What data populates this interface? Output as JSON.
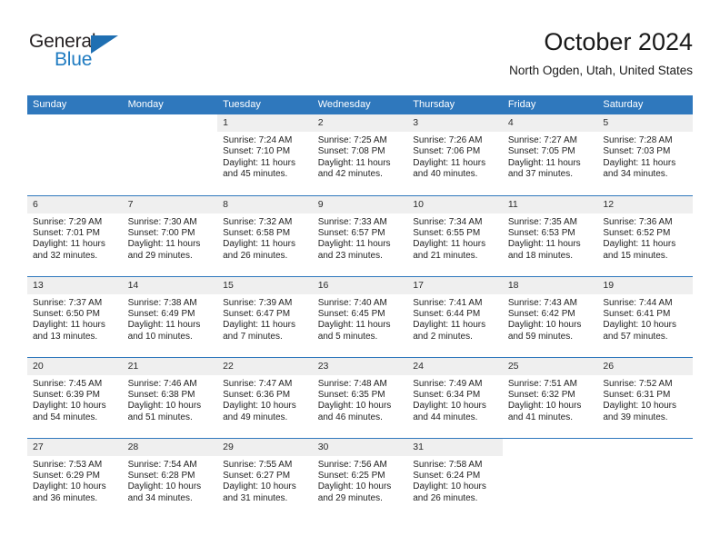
{
  "brand": {
    "name_top": "General",
    "name_bottom": "Blue",
    "triangle_color": "#1f6fb2",
    "text_color_top": "#231f20",
    "text_color_bottom": "#1f7bc1"
  },
  "header": {
    "title": "October 2024",
    "subtitle": "North Ogden, Utah, United States"
  },
  "theme": {
    "header_bg": "#2f78bd",
    "header_text": "#ffffff",
    "daynum_bg": "#efefef",
    "row_separator": "#2f78bd",
    "body_bg": "#ffffff"
  },
  "weekdays": [
    "Sunday",
    "Monday",
    "Tuesday",
    "Wednesday",
    "Thursday",
    "Friday",
    "Saturday"
  ],
  "labels": {
    "sunrise_prefix": "Sunrise:",
    "sunset_prefix": "Sunset:",
    "daylight_prefix": "Daylight:"
  },
  "weeks": [
    [
      {
        "day": "",
        "blank": true
      },
      {
        "day": "",
        "blank": true
      },
      {
        "day": "1",
        "sunrise": "Sunrise: 7:24 AM",
        "sunset": "Sunset: 7:10 PM",
        "daylight_1": "Daylight: 11 hours",
        "daylight_2": "and 45 minutes."
      },
      {
        "day": "2",
        "sunrise": "Sunrise: 7:25 AM",
        "sunset": "Sunset: 7:08 PM",
        "daylight_1": "Daylight: 11 hours",
        "daylight_2": "and 42 minutes."
      },
      {
        "day": "3",
        "sunrise": "Sunrise: 7:26 AM",
        "sunset": "Sunset: 7:06 PM",
        "daylight_1": "Daylight: 11 hours",
        "daylight_2": "and 40 minutes."
      },
      {
        "day": "4",
        "sunrise": "Sunrise: 7:27 AM",
        "sunset": "Sunset: 7:05 PM",
        "daylight_1": "Daylight: 11 hours",
        "daylight_2": "and 37 minutes."
      },
      {
        "day": "5",
        "sunrise": "Sunrise: 7:28 AM",
        "sunset": "Sunset: 7:03 PM",
        "daylight_1": "Daylight: 11 hours",
        "daylight_2": "and 34 minutes."
      }
    ],
    [
      {
        "day": "6",
        "sunrise": "Sunrise: 7:29 AM",
        "sunset": "Sunset: 7:01 PM",
        "daylight_1": "Daylight: 11 hours",
        "daylight_2": "and 32 minutes."
      },
      {
        "day": "7",
        "sunrise": "Sunrise: 7:30 AM",
        "sunset": "Sunset: 7:00 PM",
        "daylight_1": "Daylight: 11 hours",
        "daylight_2": "and 29 minutes."
      },
      {
        "day": "8",
        "sunrise": "Sunrise: 7:32 AM",
        "sunset": "Sunset: 6:58 PM",
        "daylight_1": "Daylight: 11 hours",
        "daylight_2": "and 26 minutes."
      },
      {
        "day": "9",
        "sunrise": "Sunrise: 7:33 AM",
        "sunset": "Sunset: 6:57 PM",
        "daylight_1": "Daylight: 11 hours",
        "daylight_2": "and 23 minutes."
      },
      {
        "day": "10",
        "sunrise": "Sunrise: 7:34 AM",
        "sunset": "Sunset: 6:55 PM",
        "daylight_1": "Daylight: 11 hours",
        "daylight_2": "and 21 minutes."
      },
      {
        "day": "11",
        "sunrise": "Sunrise: 7:35 AM",
        "sunset": "Sunset: 6:53 PM",
        "daylight_1": "Daylight: 11 hours",
        "daylight_2": "and 18 minutes."
      },
      {
        "day": "12",
        "sunrise": "Sunrise: 7:36 AM",
        "sunset": "Sunset: 6:52 PM",
        "daylight_1": "Daylight: 11 hours",
        "daylight_2": "and 15 minutes."
      }
    ],
    [
      {
        "day": "13",
        "sunrise": "Sunrise: 7:37 AM",
        "sunset": "Sunset: 6:50 PM",
        "daylight_1": "Daylight: 11 hours",
        "daylight_2": "and 13 minutes."
      },
      {
        "day": "14",
        "sunrise": "Sunrise: 7:38 AM",
        "sunset": "Sunset: 6:49 PM",
        "daylight_1": "Daylight: 11 hours",
        "daylight_2": "and 10 minutes."
      },
      {
        "day": "15",
        "sunrise": "Sunrise: 7:39 AM",
        "sunset": "Sunset: 6:47 PM",
        "daylight_1": "Daylight: 11 hours",
        "daylight_2": "and 7 minutes."
      },
      {
        "day": "16",
        "sunrise": "Sunrise: 7:40 AM",
        "sunset": "Sunset: 6:45 PM",
        "daylight_1": "Daylight: 11 hours",
        "daylight_2": "and 5 minutes."
      },
      {
        "day": "17",
        "sunrise": "Sunrise: 7:41 AM",
        "sunset": "Sunset: 6:44 PM",
        "daylight_1": "Daylight: 11 hours",
        "daylight_2": "and 2 minutes."
      },
      {
        "day": "18",
        "sunrise": "Sunrise: 7:43 AM",
        "sunset": "Sunset: 6:42 PM",
        "daylight_1": "Daylight: 10 hours",
        "daylight_2": "and 59 minutes."
      },
      {
        "day": "19",
        "sunrise": "Sunrise: 7:44 AM",
        "sunset": "Sunset: 6:41 PM",
        "daylight_1": "Daylight: 10 hours",
        "daylight_2": "and 57 minutes."
      }
    ],
    [
      {
        "day": "20",
        "sunrise": "Sunrise: 7:45 AM",
        "sunset": "Sunset: 6:39 PM",
        "daylight_1": "Daylight: 10 hours",
        "daylight_2": "and 54 minutes."
      },
      {
        "day": "21",
        "sunrise": "Sunrise: 7:46 AM",
        "sunset": "Sunset: 6:38 PM",
        "daylight_1": "Daylight: 10 hours",
        "daylight_2": "and 51 minutes."
      },
      {
        "day": "22",
        "sunrise": "Sunrise: 7:47 AM",
        "sunset": "Sunset: 6:36 PM",
        "daylight_1": "Daylight: 10 hours",
        "daylight_2": "and 49 minutes."
      },
      {
        "day": "23",
        "sunrise": "Sunrise: 7:48 AM",
        "sunset": "Sunset: 6:35 PM",
        "daylight_1": "Daylight: 10 hours",
        "daylight_2": "and 46 minutes."
      },
      {
        "day": "24",
        "sunrise": "Sunrise: 7:49 AM",
        "sunset": "Sunset: 6:34 PM",
        "daylight_1": "Daylight: 10 hours",
        "daylight_2": "and 44 minutes."
      },
      {
        "day": "25",
        "sunrise": "Sunrise: 7:51 AM",
        "sunset": "Sunset: 6:32 PM",
        "daylight_1": "Daylight: 10 hours",
        "daylight_2": "and 41 minutes."
      },
      {
        "day": "26",
        "sunrise": "Sunrise: 7:52 AM",
        "sunset": "Sunset: 6:31 PM",
        "daylight_1": "Daylight: 10 hours",
        "daylight_2": "and 39 minutes."
      }
    ],
    [
      {
        "day": "27",
        "sunrise": "Sunrise: 7:53 AM",
        "sunset": "Sunset: 6:29 PM",
        "daylight_1": "Daylight: 10 hours",
        "daylight_2": "and 36 minutes."
      },
      {
        "day": "28",
        "sunrise": "Sunrise: 7:54 AM",
        "sunset": "Sunset: 6:28 PM",
        "daylight_1": "Daylight: 10 hours",
        "daylight_2": "and 34 minutes."
      },
      {
        "day": "29",
        "sunrise": "Sunrise: 7:55 AM",
        "sunset": "Sunset: 6:27 PM",
        "daylight_1": "Daylight: 10 hours",
        "daylight_2": "and 31 minutes."
      },
      {
        "day": "30",
        "sunrise": "Sunrise: 7:56 AM",
        "sunset": "Sunset: 6:25 PM",
        "daylight_1": "Daylight: 10 hours",
        "daylight_2": "and 29 minutes."
      },
      {
        "day": "31",
        "sunrise": "Sunrise: 7:58 AM",
        "sunset": "Sunset: 6:24 PM",
        "daylight_1": "Daylight: 10 hours",
        "daylight_2": "and 26 minutes."
      },
      {
        "day": "",
        "blank": true
      },
      {
        "day": "",
        "blank": true
      }
    ]
  ]
}
